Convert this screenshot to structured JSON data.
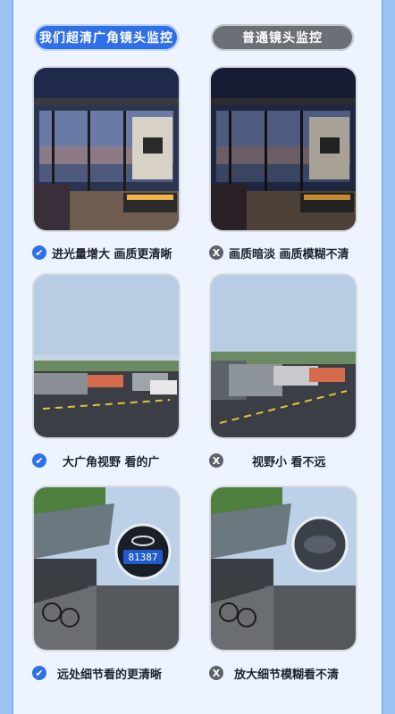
{
  "tabs": {
    "left_label": "我们超清广角镜头监控",
    "right_label": "普通镜头监控"
  },
  "rows": [
    {
      "left_caption": "进光量增大 画质更清晰",
      "right_caption": "画质暗淡 画质模糊不清"
    },
    {
      "left_caption": "大广角视野 看的广",
      "right_caption": "视野小 看不远"
    },
    {
      "left_caption": "远处细节看的更清晰",
      "right_caption": "放大细节模糊看不清",
      "plate_text": "81387"
    }
  ],
  "icons": {
    "check": "check-icon",
    "cross": "x-icon",
    "check_glyph": "✔",
    "cross_glyph": "X"
  },
  "colors": {
    "accent": "#2f6fe8",
    "gray": "#5e636b",
    "page_bg": "#eef4ff"
  }
}
